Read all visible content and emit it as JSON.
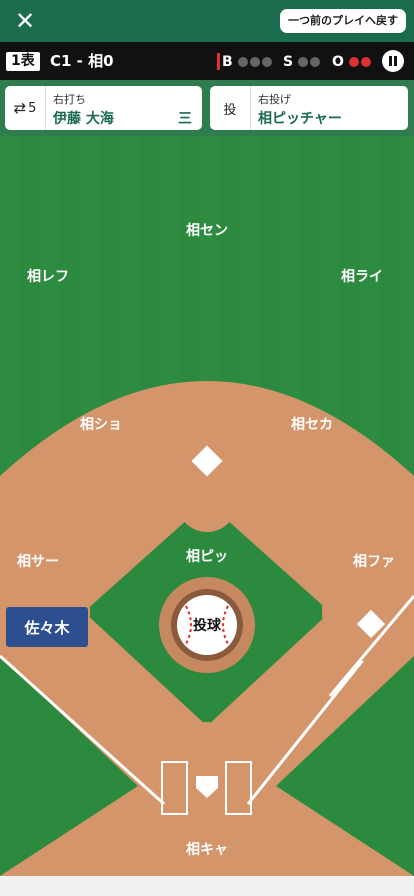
{
  "header": {
    "close_icon": "close-icon",
    "back_button": "一つ前のプレイへ戻す"
  },
  "scoreboard": {
    "inning": "1表",
    "score": "C1 - 相0",
    "balls_label": "B",
    "strikes_label": "S",
    "outs_label": "O",
    "balls": 0,
    "strikes": 0,
    "outs": 2,
    "pause_icon": "pause-icon"
  },
  "batter": {
    "order": "5",
    "swap_icon": "swap-icon",
    "kind": "右打ち",
    "name": "伊藤 大海",
    "position": "三"
  },
  "pitcher": {
    "section": "投",
    "kind": "右投げ",
    "name": "相ピッチャー"
  },
  "fielders": {
    "cf": "相セン",
    "lf": "相レフ",
    "rf": "相ライ",
    "ss": "相ショ",
    "second": "相セカ",
    "third": "相サー",
    "first": "相ファ",
    "pitcher": "相ピッ",
    "catcher": "相キャ"
  },
  "runner": {
    "name": "佐々木"
  },
  "pitch_button": "投球",
  "colors": {
    "header_green": "#1b6b4d",
    "grass_dark": "#2b8a3e",
    "grass_light": "#2e8c42",
    "dirt": "#d4956a",
    "runner_blue": "#2d4f8f",
    "ball_red": "#e03131"
  }
}
